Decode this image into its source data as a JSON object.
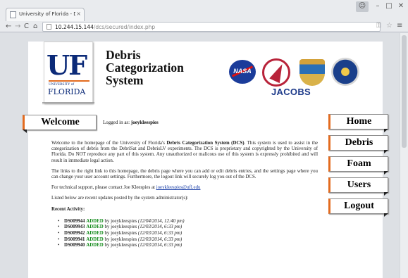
{
  "browser": {
    "tab_title": "University of Florida - DCS",
    "tab_close": "×",
    "url_host": "10.244.15.144",
    "url_path": "/dcs/secured/index.php",
    "icons": {
      "back": "←",
      "forward": "→",
      "reload": "C",
      "home": "⌂",
      "key": "⚿",
      "star": "☆",
      "menu": "≡",
      "minimize": "–",
      "maximize": "□",
      "close": "✕"
    }
  },
  "header": {
    "uf_letters": "UF",
    "uf_university": "UNIVERSITY of",
    "uf_florida": "FLORIDA",
    "title_line1": "Debris",
    "title_line2": "Categorization",
    "title_line3": "System",
    "nasa_text": "NASA",
    "jacobs_text": "JACOBS"
  },
  "section": {
    "welcome": "Welcome",
    "logged_in_label": "Logged in as:",
    "username": "joeykleespies"
  },
  "nav": {
    "home": "Home",
    "debris": "Debris",
    "foam": "Foam",
    "users": "Users",
    "logout": "Logout"
  },
  "content": {
    "p1_a": "Welcome to the homepage of the University of Florida's ",
    "p1_b": "Debris Categorization System (DCS)",
    "p1_c": ". This system is used to assist in the categorization of debris from the DebriSat and DebrisLV experiments. The DCS is proprietary and copyrighted by the University of Florida. Do NOT reproduce any part of this system. Any unauthorized or malicous use of this system is expressly prohibited and will result in immediate legal action.",
    "p2": "The links to the right link to this homepage, the debris page where you can add or edit debris entries, and the settings page where you can change your user account settings. Furthermore, the logout link will securely log you out of the DCS.",
    "p3_a": "For technical support, please contact Joe Kleespies at ",
    "p3_link": "joeykleespies@ufl.edu",
    "p4": "Listed below are recent updates posted by the system administrator(s):",
    "recent_title": "Recent Activity:",
    "activity": [
      {
        "id": "DS009944",
        "action": "ADDED",
        "by": " by joeykleespies ",
        "time": "(12/04/2014, 12:40 pm)"
      },
      {
        "id": "DS009943",
        "action": "ADDED",
        "by": " by joeykleespies ",
        "time": "(12/03/2014, 6:33 pm)"
      },
      {
        "id": "DS009942",
        "action": "ADDED",
        "by": " by joeykleespies ",
        "time": "(12/03/2014, 6:33 pm)"
      },
      {
        "id": "DS009941",
        "action": "ADDED",
        "by": " by joeykleespies ",
        "time": "(12/03/2014, 6:33 pm)"
      },
      {
        "id": "DS009940",
        "action": "ADDED",
        "by": " by joeykleespies ",
        "time": "(12/03/2014, 6:33 pm)"
      }
    ]
  }
}
